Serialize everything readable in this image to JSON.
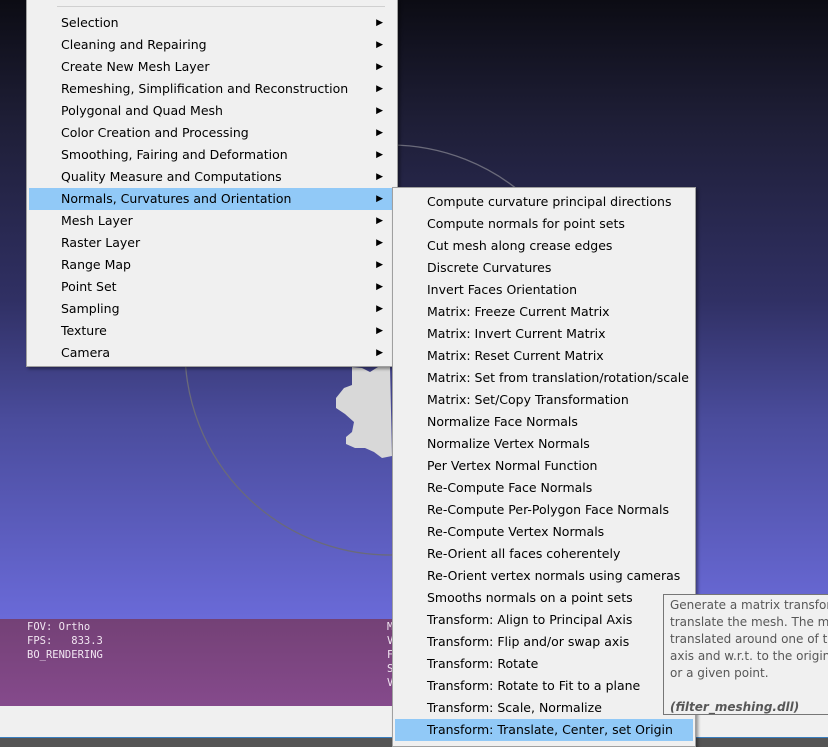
{
  "main_menu": {
    "items": [
      {
        "label": "Selection"
      },
      {
        "label": "Cleaning and Repairing"
      },
      {
        "label": "Create New Mesh Layer"
      },
      {
        "label": "Remeshing, Simplification and Reconstruction"
      },
      {
        "label": "Polygonal and Quad Mesh"
      },
      {
        "label": "Color Creation and Processing"
      },
      {
        "label": "Smoothing, Fairing and Deformation"
      },
      {
        "label": "Quality Measure and Computations"
      },
      {
        "label": "Normals, Curvatures and Orientation",
        "highlighted": true
      },
      {
        "label": "Mesh Layer"
      },
      {
        "label": "Raster Layer"
      },
      {
        "label": "Range Map"
      },
      {
        "label": "Point Set"
      },
      {
        "label": "Sampling"
      },
      {
        "label": "Texture"
      },
      {
        "label": "Camera"
      }
    ],
    "arrow_icon": "submenu-arrow"
  },
  "submenu": {
    "items": [
      {
        "label": "Compute curvature principal directions"
      },
      {
        "label": "Compute normals for point sets"
      },
      {
        "label": "Cut mesh along crease edges"
      },
      {
        "label": "Discrete Curvatures"
      },
      {
        "label": "Invert Faces Orientation"
      },
      {
        "label": "Matrix: Freeze Current Matrix"
      },
      {
        "label": "Matrix: Invert Current Matrix"
      },
      {
        "label": "Matrix: Reset Current Matrix"
      },
      {
        "label": "Matrix: Set from translation/rotation/scale"
      },
      {
        "label": "Matrix: Set/Copy Transformation"
      },
      {
        "label": "Normalize Face Normals"
      },
      {
        "label": "Normalize Vertex Normals"
      },
      {
        "label": "Per Vertex Normal Function"
      },
      {
        "label": "Re-Compute Face Normals"
      },
      {
        "label": "Re-Compute Per-Polygon Face Normals"
      },
      {
        "label": "Re-Compute Vertex Normals"
      },
      {
        "label": "Re-Orient all faces coherentely"
      },
      {
        "label": "Re-Orient vertex normals using cameras"
      },
      {
        "label": "Smooths normals on a point sets"
      },
      {
        "label": "Transform: Align to Principal Axis"
      },
      {
        "label": "Transform: Flip and/or swap axis"
      },
      {
        "label": "Transform: Rotate"
      },
      {
        "label": "Transform: Rotate to Fit to a plane"
      },
      {
        "label": "Transform: Scale, Normalize"
      },
      {
        "label": "Transform: Translate, Center, set Origin",
        "highlighted": true
      }
    ]
  },
  "tooltip": {
    "lines": [
      "Generate a matrix transform",
      "translate the mesh. The mes",
      "translated around one of th",
      "axis and w.r.t. to the origin",
      "or a given point."
    ],
    "plugin": "(filter_meshing.dll)"
  },
  "info": {
    "left": [
      "FOV: Ortho",
      "FPS:   833.3",
      "BO_RENDERING"
    ],
    "right": [
      "M",
      "V",
      "F",
      "S",
      "V"
    ]
  },
  "colors": {
    "highlight": "#91c9f7",
    "menu_bg": "#f0f0f0",
    "info_bar": "#7c4580",
    "mesh": "#d8d8d8"
  }
}
